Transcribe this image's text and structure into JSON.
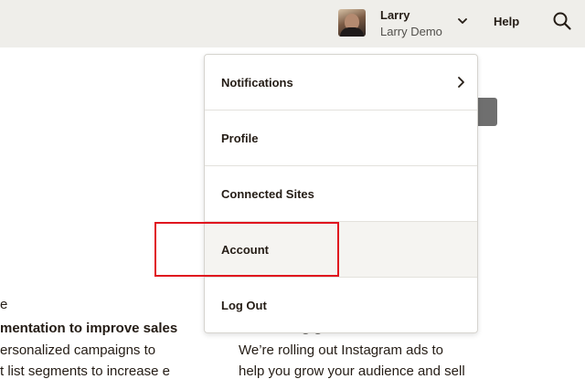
{
  "header": {
    "user_name": "Larry",
    "account_name": "Larry Demo",
    "help_label": "Help"
  },
  "icons": {
    "avatar": "user-photo",
    "account_menu_toggle": "chevron-down-icon",
    "search": "search-icon",
    "submenu": "chevron-right-icon"
  },
  "menu": {
    "items": [
      {
        "label": "Notifications"
      },
      {
        "label": "Profile"
      },
      {
        "label": "Connected Sites"
      },
      {
        "label": "Account"
      },
      {
        "label": "Log Out"
      }
    ]
  },
  "background": {
    "left_heading_fragment": "e",
    "left_headline": "mentation to improve sales",
    "left_body_1": "ersonalized campaigns to",
    "left_body_2": "t list segments to increase e",
    "right_heading_fragment": "g   g",
    "right_body_1": "We’re rolling out Instagram ads to",
    "right_body_2": "help you grow your audience and sell"
  },
  "colors": {
    "header_bg": "#efeeea",
    "highlight": "#e0141e",
    "menu_hover": "#f5f4f1"
  }
}
